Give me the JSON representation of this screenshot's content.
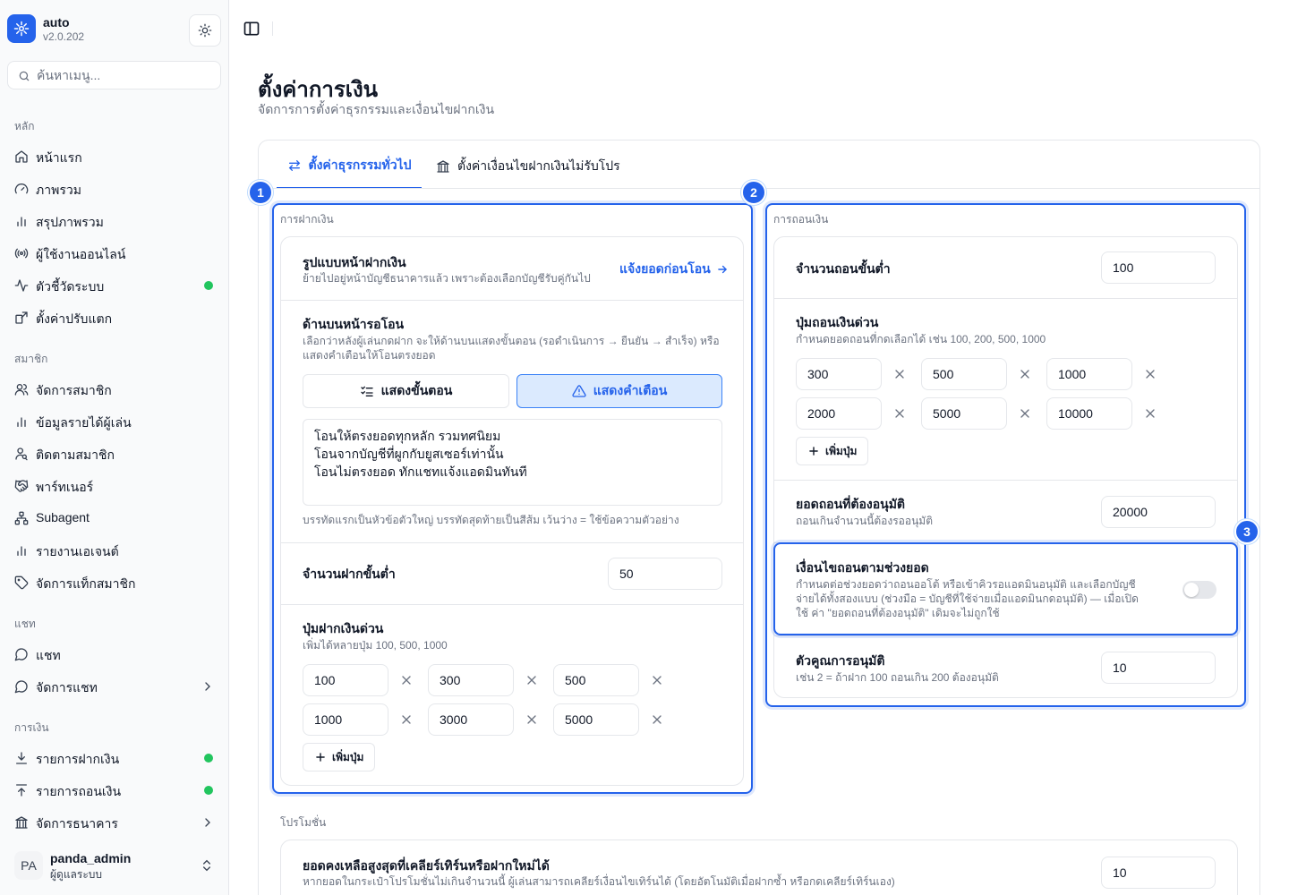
{
  "app": {
    "name": "auto",
    "version": "v2.0.202"
  },
  "search": {
    "placeholder": "ค้นหาเมนู..."
  },
  "sidebar": {
    "sections": [
      {
        "label": "หลัก"
      },
      {
        "label": "สมาชิก"
      },
      {
        "label": "แชท"
      },
      {
        "label": "การเงิน"
      }
    ],
    "items": [
      {
        "label": "หน้าแรก",
        "icon": "home-icon"
      },
      {
        "label": "ภาพรวม",
        "icon": "gauge-icon"
      },
      {
        "label": "สรุปภาพรวม",
        "icon": "bar-chart-icon"
      },
      {
        "label": "ผู้ใช้งานออนไลน์",
        "icon": "radio-icon",
        "dot": false
      },
      {
        "label": "ตัวชี้วัดระบบ",
        "icon": "activity-icon",
        "dot": true
      },
      {
        "label": "ตั้งค่าปรับแตก",
        "icon": "share-icon"
      },
      {
        "label": "จัดการสมาชิก",
        "icon": "users-icon"
      },
      {
        "label": "ข้อมูลรายได้ผู้เล่น",
        "icon": "bar-chart-icon"
      },
      {
        "label": "ติดตามสมาชิก",
        "icon": "user-search-icon"
      },
      {
        "label": "พาร์ทเนอร์",
        "icon": "handshake-icon"
      },
      {
        "label": "Subagent",
        "icon": "network-icon"
      },
      {
        "label": "รายงานเอเจนต์",
        "icon": "bar-chart-icon"
      },
      {
        "label": "จัดการแท็กสมาชิก",
        "icon": "tag-icon"
      },
      {
        "label": "แชท",
        "icon": "message-icon"
      },
      {
        "label": "จัดการแชท",
        "icon": "message-icon"
      },
      {
        "label": "รายการฝากเงิน",
        "icon": "download-icon",
        "dot": true
      },
      {
        "label": "รายการถอนเงิน",
        "icon": "upload-icon",
        "dot": true
      },
      {
        "label": "จัดการธนาคาร",
        "icon": "bank-icon"
      }
    ]
  },
  "user": {
    "initials": "PA",
    "name": "panda_admin",
    "role": "ผู้ดูแลระบบ"
  },
  "page": {
    "title": "ตั้งค่าการเงิน",
    "subtitle": "จัดการการตั้งค่าธุรกรรมและเงื่อนไขฝากเงิน"
  },
  "tabs": [
    {
      "label": "ตั้งค่าธุรกรรมทั่วไป",
      "active": true
    },
    {
      "label": "ตั้งค่าเงื่อนไขฝากเงินไม่รับโปร",
      "active": false
    }
  ],
  "deposit": {
    "group_title": "การฝากเงิน",
    "page_style": {
      "label": "รูปแบบหน้าฝากเงิน",
      "desc": "ย้ายไปอยู่หน้าบัญชีธนาคารแล้ว เพราะต้องเลือกบัญชีรับคู่กันไป",
      "action": "แจ้งยอดก่อนโอน"
    },
    "banner": {
      "label": "ด้านบนหน้ารอโอน",
      "desc": "เลือกว่าหลังผู้เล่นกดฝาก จะให้ด้านบนแสดงขั้นตอน (รอดำเนินการ → ยืนยัน → สำเร็จ) หรือแสดงคำเตือนให้โอนตรงยอด",
      "option_steps": "แสดงขั้นตอน",
      "option_warning": "แสดงคำเตือน",
      "text_lines": [
        "โอนให้ตรงยอดทุกหลัก รวมทศนิยม",
        "โอนจากบัญชีที่ผูกกับยูสเซอร์เท่านั้น",
        "โอนไม่ตรงยอด ทักแชทแจ้งแอดมินทันที"
      ],
      "hint": "บรรทัดแรกเป็นหัวข้อตัวใหญ่ บรรทัดสุดท้ายเป็นสีส้ม เว้นว่าง = ใช้ข้อความตัวอย่าง"
    },
    "min": {
      "label": "จำนวนฝากขั้นต่ำ",
      "value": "50"
    },
    "quick": {
      "label": "ปุ่มฝากเงินด่วน",
      "desc": "เพิ่มได้หลายปุ่ม 100, 500, 1000",
      "values": [
        "100",
        "300",
        "500",
        "1000",
        "3000",
        "5000"
      ],
      "add_label": "เพิ่มปุ่ม"
    }
  },
  "withdraw": {
    "group_title": "การถอนเงิน",
    "min": {
      "label": "จำนวนถอนขั้นต่ำ",
      "value": "100"
    },
    "quick": {
      "label": "ปุ่มถอนเงินด่วน",
      "desc": "กำหนดยอดถอนที่กดเลือกได้ เช่น 100, 200, 500, 1000",
      "values": [
        "300",
        "500",
        "1000",
        "2000",
        "5000",
        "10000"
      ],
      "add_label": "เพิ่มปุ่ม"
    },
    "approve": {
      "label": "ยอดถอนที่ต้องอนุมัติ",
      "desc": "ถอนเกินจำนวนนี้ต้องรออนุมัติ",
      "value": "20000"
    },
    "range": {
      "label": "เงื่อนไขถอนตามช่วงยอด",
      "desc": "กำหนดต่อช่วงยอดว่าถอนออโต้ หรือเข้าคิวรอแอดมินอนุมัติ และเลือกบัญชีจ่ายได้ทั้งสองแบบ (ช่วงมือ = บัญชีที่ใช้จ่ายเมื่อแอดมินกดอนุมัติ) — เมื่อเปิดใช้ ค่า \"ยอดถอนที่ต้องอนุมัติ\" เดิมจะไม่ถูกใช้",
      "enabled": false
    },
    "multiplier": {
      "label": "ตัวคูณการอนุมัติ",
      "desc": "เช่น 2 = ถ้าฝาก 100 ถอนเกิน 200 ต้องอนุมัติ",
      "value": "10"
    }
  },
  "promo": {
    "group_title": "โปรโมชั่น",
    "max_balance": {
      "label": "ยอดคงเหลือสูงสุดที่เคลียร์เทิร์นหรือฝากใหม่ได้",
      "desc": "หากยอดในกระเป๋าโปรโมชั่นไม่เกินจำนวนนี้ ผู้เล่นสามารถเคลียร์เงื่อนไขเทิร์นได้ (โดยอัตโนมัติเมื่อฝากซ้ำ หรือกดเคลียร์เทิร์นเอง)",
      "value": "10"
    }
  },
  "annotations": [
    "1",
    "2",
    "3"
  ],
  "colors": {
    "accent": "#2563eb",
    "dot": "#22c55e",
    "active_bg": "#dbeafe"
  }
}
